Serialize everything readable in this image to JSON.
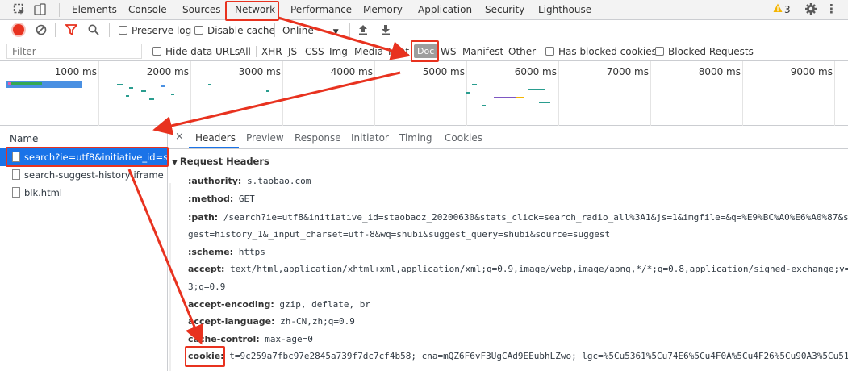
{
  "tabs": {
    "items": [
      "Elements",
      "Console",
      "Sources",
      "Network",
      "Performance",
      "Memory",
      "Application",
      "Security",
      "Lighthouse"
    ],
    "active": "Network",
    "warn_count": "3"
  },
  "toolbar": {
    "preserve_log": "Preserve log",
    "disable_cache": "Disable cache",
    "throttle": "Online"
  },
  "filter": {
    "placeholder": "Filter",
    "hide_data_urls": "Hide data URLs",
    "types": [
      "All",
      "XHR",
      "JS",
      "CSS",
      "Img",
      "Media",
      "Font",
      "Doc",
      "WS",
      "Manifest",
      "Other"
    ],
    "selected_type": "Doc",
    "has_blocked": "Has blocked cookies",
    "blocked_requests": "Blocked Requests"
  },
  "timeline": {
    "labels": [
      "1000 ms",
      "2000 ms",
      "3000 ms",
      "4000 ms",
      "5000 ms",
      "6000 ms",
      "7000 ms",
      "8000 ms",
      "9000 ms"
    ]
  },
  "requests": {
    "header": "Name",
    "items": [
      "search?ie=utf8&initiative_id=s...",
      "search-suggest-history-iframe",
      "blk.html"
    ]
  },
  "detail": {
    "close": "×",
    "tabs": [
      "Headers",
      "Preview",
      "Response",
      "Initiator",
      "Timing",
      "Cookies"
    ],
    "active_tab": "Headers",
    "section": "Request Headers",
    "headers": [
      {
        "k": ":authority:",
        "v": "s.taobao.com"
      },
      {
        "k": ":method:",
        "v": "GET"
      },
      {
        "k": ":path:",
        "v": "/search?ie=utf8&initiative_id=staobaoz_20200630&stats_click=search_radio_all%3A1&js=1&imgfile=&q=%E9%BC%A0%E6%A0%87&su"
      },
      {
        "k": "",
        "v": "gest=history_1&_input_charset=utf-8&wq=shubi&suggest_query=shubi&source=suggest"
      },
      {
        "k": ":scheme:",
        "v": "https"
      },
      {
        "k": "accept:",
        "v": "text/html,application/xhtml+xml,application/xml;q=0.9,image/webp,image/apng,*/*;q=0.8,application/signed-exchange;v=b"
      },
      {
        "k": "",
        "v": "3;q=0.9"
      },
      {
        "k": "accept-encoding:",
        "v": "gzip, deflate, br"
      },
      {
        "k": "accept-language:",
        "v": "zh-CN,zh;q=0.9"
      },
      {
        "k": "cache-control:",
        "v": "max-age=0"
      },
      {
        "k": "cookie:",
        "v": "t=9c259a7fbc97e2845a739f7dc7cf4b58; cna=mQZ6F6vF3UgCAd9EEubhLZwo; lgc=%5Cu5361%5Cu74E6%5Cu4F0A%5Cu4F26%5Cu90A3%5Cu51E"
      }
    ]
  }
}
